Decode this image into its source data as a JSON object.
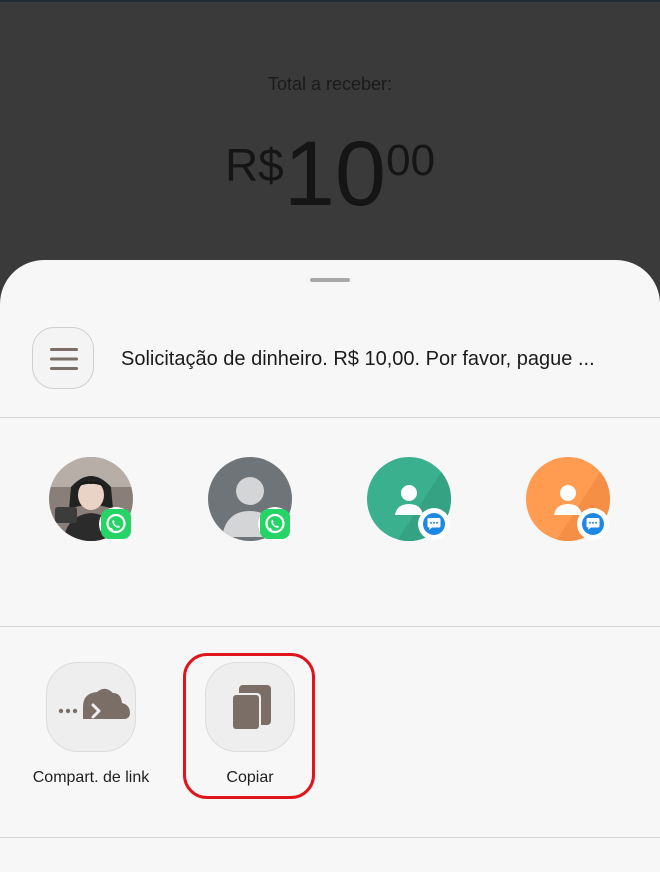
{
  "header": {
    "total_label": "Total a receber:",
    "currency": "R$",
    "amount_int": "10",
    "amount_dec": "00"
  },
  "share_sheet": {
    "message_preview": "Solicitação de dinheiro. R$ 10,00. Por favor, pague ...",
    "contacts": [
      {
        "app_badge": "whatsapp-icon",
        "avatar": "photo"
      },
      {
        "app_badge": "whatsapp-icon",
        "avatar": "default-person"
      },
      {
        "app_badge": "messages-icon",
        "avatar": "person-green"
      },
      {
        "app_badge": "messages-icon",
        "avatar": "person-orange"
      }
    ],
    "actions": [
      {
        "label": "Compart. de link",
        "icon": "cloud-link-icon"
      },
      {
        "label": "Copiar",
        "icon": "copy-icon"
      }
    ]
  },
  "colors": {
    "backdrop": "#3a3a3a",
    "sheet": "#f7f7f7",
    "whatsapp": "#25d366",
    "messages": "#1e88e5",
    "highlight": "#e0141b",
    "icon_brown": "#7b6e66"
  }
}
